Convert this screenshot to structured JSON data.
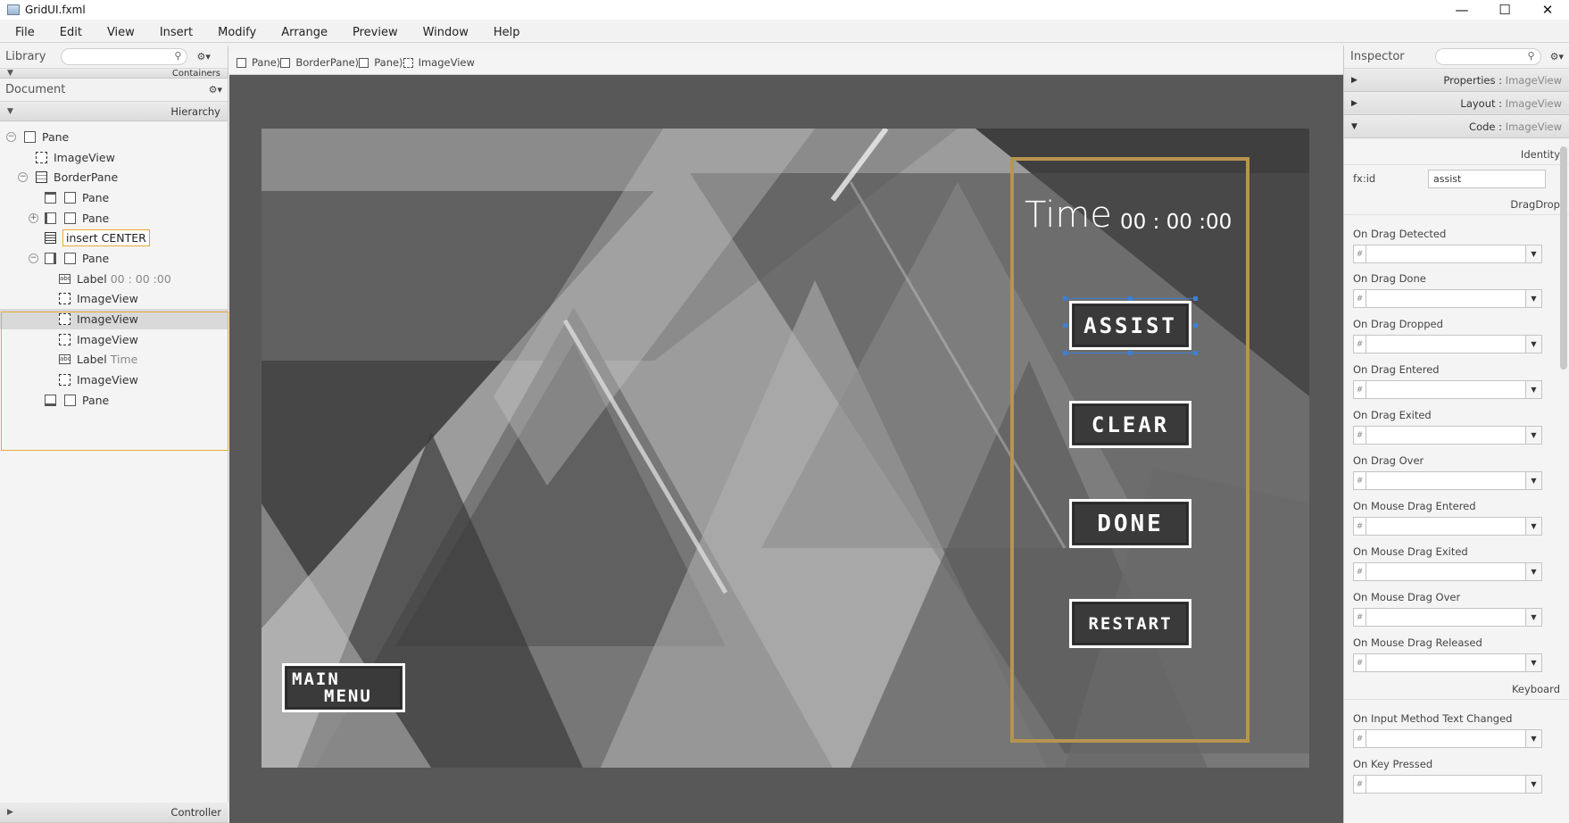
{
  "window": {
    "title": "GridUI.fxml",
    "minimize": "—",
    "maximize": "☐",
    "close": "✕"
  },
  "menu": [
    "File",
    "Edit",
    "View",
    "Insert",
    "Modify",
    "Arrange",
    "Preview",
    "Window",
    "Help"
  ],
  "library": {
    "title": "Library",
    "section": "Containers"
  },
  "document": {
    "title": "Document",
    "section": "Hierarchy"
  },
  "hierarchy": [
    {
      "label": "Pane",
      "sub": ""
    },
    {
      "label": "ImageView",
      "sub": ""
    },
    {
      "label": "BorderPane",
      "sub": ""
    },
    {
      "label": "Pane",
      "sub": ""
    },
    {
      "label": "Pane",
      "sub": ""
    },
    {
      "label": "insert CENTER",
      "sub": ""
    },
    {
      "label": "Pane",
      "sub": ""
    },
    {
      "label": "Label",
      "sub": "00 : 00 :00"
    },
    {
      "label": "ImageView",
      "sub": ""
    },
    {
      "label": "ImageView",
      "sub": ""
    },
    {
      "label": "ImageView",
      "sub": ""
    },
    {
      "label": "Label",
      "sub": "Time"
    },
    {
      "label": "ImageView",
      "sub": ""
    },
    {
      "label": "Pane",
      "sub": ""
    }
  ],
  "controller": "Controller",
  "breadcrumb": [
    "Pane",
    "BorderPane",
    "Pane",
    "ImageView"
  ],
  "scene": {
    "time_label": "Time",
    "time_value": "00 : 00 :00",
    "assist": "ASSIST",
    "clear": "CLEAR",
    "done": "DONE",
    "restart": "RESTART",
    "main_menu_1": "MAIN",
    "main_menu_2": "MENU"
  },
  "inspector": {
    "title": "Inspector",
    "sections": [
      {
        "name": "Properties",
        "sub": "ImageView"
      },
      {
        "name": "Layout",
        "sub": "ImageView"
      },
      {
        "name": "Code",
        "sub": "ImageView"
      }
    ],
    "identity": "Identity",
    "fxid_label": "fx:id",
    "fxid_value": "assist",
    "dragdrop": "DragDrop",
    "keyboard": "Keyboard",
    "events": [
      "On Drag Detected",
      "On Drag Done",
      "On Drag Dropped",
      "On Drag Entered",
      "On Drag Exited",
      "On Drag Over",
      "On Mouse Drag Entered",
      "On Mouse Drag Exited",
      "On Mouse Drag Over",
      "On Mouse Drag Released"
    ],
    "keyboard_events": [
      "On Input Method Text Changed",
      "On Key Pressed"
    ]
  },
  "colors": {
    "selection_outline": "#e9a93a",
    "timebox_border": "#b8944f",
    "handle": "#3d7fd6"
  }
}
